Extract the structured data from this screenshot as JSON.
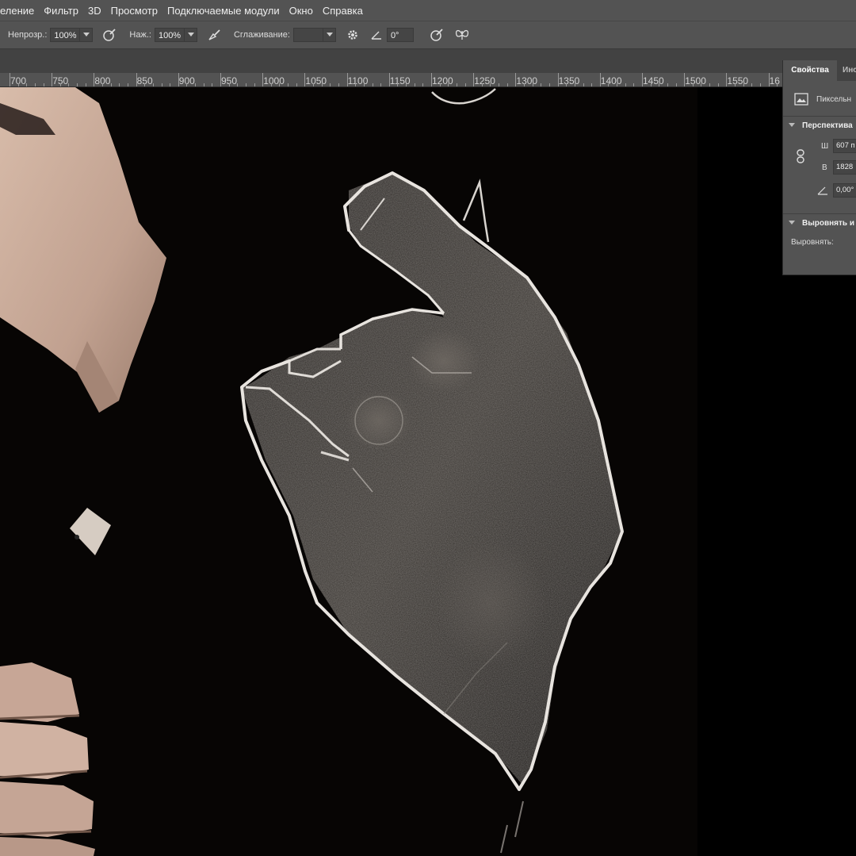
{
  "menu": {
    "items": [
      "еление",
      "Фильтр",
      "3D",
      "Просмотр",
      "Подключаемые модули",
      "Окно",
      "Справка"
    ]
  },
  "options": {
    "opacity_label": "Непрозр.:",
    "opacity_value": "100%",
    "pressure_label": "Наж.:",
    "pressure_value": "100%",
    "smoothing_label": "Сглаживание:",
    "smoothing_value": "",
    "angle_value": "0°",
    "icons": [
      "pressure-opacity-icon",
      "airbrush-icon",
      "gear-icon",
      "angle-icon",
      "pressure-size-icon",
      "symmetry-butterfly-icon"
    ]
  },
  "ruler": {
    "labels": [
      "700",
      "750",
      "800",
      "850",
      "900",
      "950",
      "1000",
      "1050",
      "1100",
      "1150",
      "1200",
      "1250",
      "1300",
      "1350",
      "1400",
      "1450",
      "1500",
      "1550",
      "16"
    ]
  },
  "properties": {
    "tab_active": "Свойства",
    "tab_second": "Инс",
    "layer_type": "Пиксельн",
    "section_transform": "Перспектива",
    "w_label": "Ш",
    "w_value": "607 п",
    "h_label": "В",
    "h_value": "1828",
    "angle_value": "0,00°",
    "section_align": "Выровнять и",
    "align_label": "Выровнять:"
  },
  "colors": {
    "ui_bg": "#535353",
    "ui_dark": "#424242",
    "canvas_bg": "#050403",
    "skin": "#c9aa98",
    "chalk": "#e8e4df"
  }
}
